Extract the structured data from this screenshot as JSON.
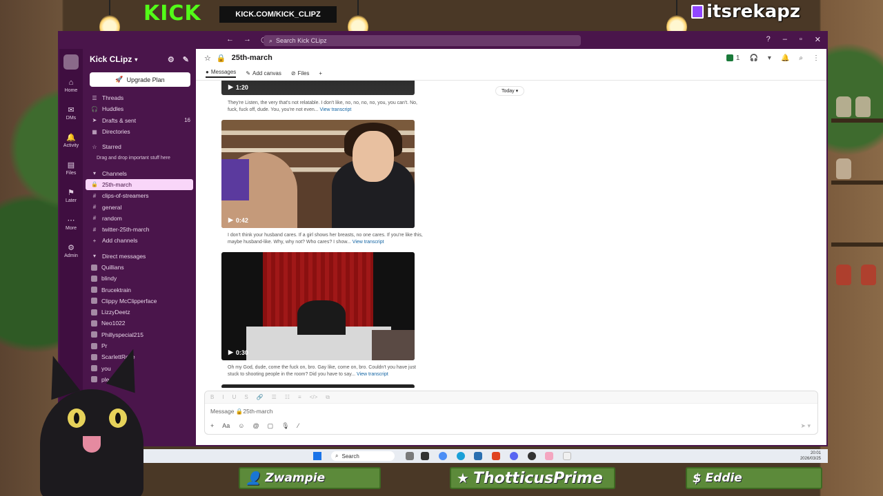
{
  "overlay": {
    "kick_logo": "KICK",
    "kick_url": "KICK.COM/KICK_CLIPZ",
    "twitch_name": "itsrekapz",
    "banners": [
      {
        "icon": "person-icon",
        "label": "Zwampie"
      },
      {
        "icon": "star-icon",
        "label": "ThotticusPrime"
      },
      {
        "icon": "dollar-icon",
        "label": "Eddie"
      }
    ]
  },
  "titlebar": {
    "search_placeholder": "Search Kick CLipz"
  },
  "rail": [
    {
      "icon": "home-icon",
      "label": "Home"
    },
    {
      "icon": "dms-icon",
      "label": "DMs"
    },
    {
      "icon": "bell-icon",
      "label": "Activity"
    },
    {
      "icon": "files-icon",
      "label": "Files"
    },
    {
      "icon": "bookmark-icon",
      "label": "Later"
    },
    {
      "icon": "more-icon",
      "label": "More"
    },
    {
      "icon": "gear-icon",
      "label": "Admin"
    }
  ],
  "sidebar": {
    "workspace": "Kick CLipz",
    "upgrade": "Upgrade Plan",
    "nav": [
      {
        "label": "Threads",
        "icon": "threads-icon"
      },
      {
        "label": "Huddles",
        "icon": "headphones-icon"
      },
      {
        "label": "Drafts & sent",
        "icon": "send-icon",
        "count": "16"
      },
      {
        "label": "Directories",
        "icon": "directory-icon"
      }
    ],
    "starred_label": "Starred",
    "starred_note": "Drag and drop important stuff here",
    "channels_label": "Channels",
    "channels": [
      {
        "label": "25th-march",
        "icon": "lock-icon",
        "active": true
      },
      {
        "label": "clips-of-streamers",
        "icon": "hash-icon"
      },
      {
        "label": "general",
        "icon": "hash-icon"
      },
      {
        "label": "random",
        "icon": "hash-icon"
      },
      {
        "label": "twitter-25th-march",
        "icon": "hash-icon"
      },
      {
        "label": "Add channels",
        "icon": "plus-icon"
      }
    ],
    "dm_label": "Direct messages",
    "dms": [
      "Quillians",
      "blindy",
      "Brucektrain",
      "Clippy McClipperface",
      "LizzyDeetz",
      "Neo1022",
      "Phillyspecial215",
      "Pr",
      "ScarlettRose",
      "you",
      "ple"
    ]
  },
  "channel": {
    "name": "25th-march",
    "member_count": "1",
    "tabs": [
      "Messages",
      "Add canvas",
      "Files"
    ],
    "today": "Today"
  },
  "messages": [
    {
      "duration": "1:20",
      "transcript": "They're Listen, the very that's not relatable. I don't like, no, no, no, no, you, you can't. No, fuck, fuck off, dude. You, you're not even...",
      "link": "View transcript"
    },
    {
      "duration": "0:42",
      "transcript": "I don't think your husband cares. If a girl shows her breasts, no one cares. If you're like this, maybe husband-like. Why, why not? Who cares? I show...",
      "link": "View transcript"
    },
    {
      "duration": "0:30",
      "transcript": "Oh my God, dude, come the fuck on, bro. Gay like, come on, bro. Couldn't you have just stuck to shooting people in the room? Did you have to say...",
      "link": "View transcript"
    }
  ],
  "composer": {
    "placeholder": "Message 🔒25th-march",
    "format_tools": [
      "B",
      "I",
      "U",
      "S",
      "🔗",
      "☰",
      "☷",
      "≡",
      "</>",
      "⧉"
    ],
    "tools": [
      "+",
      "Aa",
      "☺",
      "@",
      "▢",
      "🎙",
      "⁄"
    ]
  },
  "taskbar": {
    "search": "Search",
    "time": "20:01",
    "date": "2026/03/25"
  }
}
